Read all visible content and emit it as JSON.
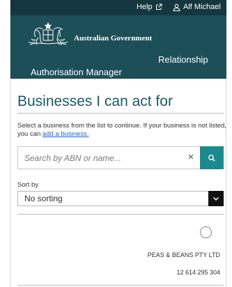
{
  "header": {
    "help_label": "Help",
    "user_label": "Alf Michael",
    "government_title": "Australian Government",
    "app_title_line1": "Relationship",
    "app_title_line2": "Authorisation Manager"
  },
  "main": {
    "title": "Businesses I can act for",
    "intro_text": "Select a business from the list to continue. If your business is not listed, you can ",
    "add_business_link": "add a business.",
    "search": {
      "placeholder": "Search by ABN or name...",
      "value": "",
      "clear_symbol": "×"
    },
    "sort": {
      "label": "Sort by",
      "selected": "No sorting"
    },
    "businesses": [
      {
        "name": "PEAS & BEANS PTY LTD",
        "abn": "12 614 295 304",
        "selected": false
      }
    ]
  },
  "colors": {
    "header_bg": "#1d4f59",
    "topbar_bg": "#14363f",
    "title_color": "#1d5862",
    "search_button": "#1a8a8f",
    "link": "#1b5fd1"
  },
  "icons": {
    "help": "external-link-icon",
    "user": "user-icon",
    "search": "search-icon",
    "sort": "chevron-down-icon",
    "crest": "coat-of-arms-icon"
  }
}
